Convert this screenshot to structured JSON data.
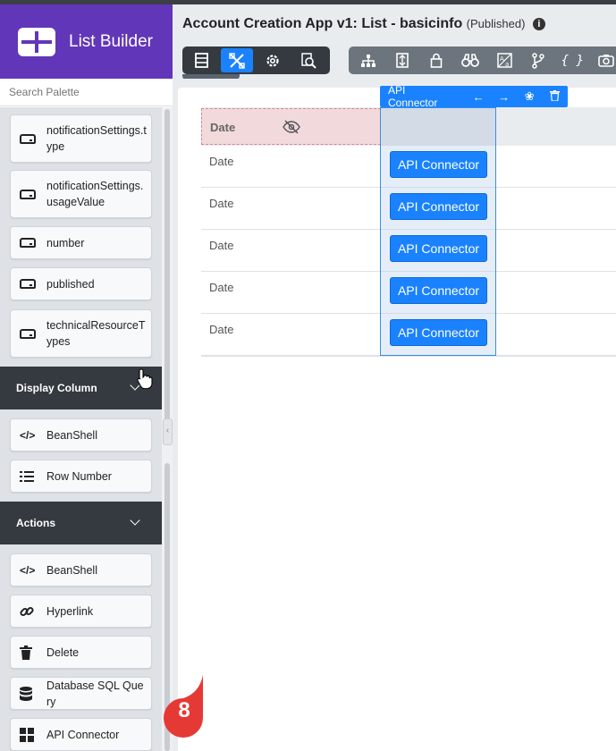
{
  "brand": {
    "title": "List Builder"
  },
  "header": {
    "app_title": "Account Creation App v1: List - basicinfo",
    "status": "(Published)",
    "info_symbol": "i"
  },
  "toolbar_primary": [
    {
      "icon": "list-layout-icon",
      "active": false
    },
    {
      "icon": "design-tools-icon",
      "active": true
    },
    {
      "icon": "gear-icon",
      "active": false
    },
    {
      "icon": "preview-search-icon",
      "active": false
    }
  ],
  "toolbar_secondary": [
    {
      "icon": "sitemap-icon"
    },
    {
      "icon": "import-export-icon"
    },
    {
      "icon": "lock-icon"
    },
    {
      "icon": "binoculars-icon"
    },
    {
      "icon": "translate-icon"
    },
    {
      "icon": "git-branch-icon"
    },
    {
      "icon": "code-braces-icon",
      "label": "{ }"
    },
    {
      "icon": "camera-icon"
    }
  ],
  "sidebar": {
    "search_placeholder": "Search Palette",
    "items_top": [
      {
        "label": "notificationSettings.type",
        "icon": "drive-icon"
      },
      {
        "label": "notificationSettings.usageValue",
        "icon": "drive-icon"
      },
      {
        "label": "number",
        "icon": "drive-icon"
      },
      {
        "label": "published",
        "icon": "drive-icon"
      },
      {
        "label": "technicalResourceTypes",
        "icon": "drive-icon"
      }
    ],
    "section_display": "Display Column",
    "items_display": [
      {
        "label": "BeanShell",
        "icon": "code-icon"
      },
      {
        "label": "Row Number",
        "icon": "list-numbered-icon"
      }
    ],
    "section_actions": "Actions",
    "items_actions": [
      {
        "label": "BeanShell",
        "icon": "code-icon"
      },
      {
        "label": "Hyperlink",
        "icon": "link-icon"
      },
      {
        "label": "Delete",
        "icon": "trash-icon"
      },
      {
        "label": "Database SQL Query",
        "icon": "database-icon"
      },
      {
        "label": "API Connector",
        "icon": "grid-icon"
      }
    ]
  },
  "table": {
    "header": "Date",
    "rows": [
      "Date",
      "Date",
      "Date",
      "Date",
      "Date"
    ]
  },
  "api_column": {
    "toolbar_label": "API Connector",
    "button_label": "API Connector"
  },
  "step_marker": "8",
  "colors": {
    "brand": "#6236b8",
    "accent": "#1a82ff",
    "dark": "#343a40",
    "marker": "#e53935"
  }
}
